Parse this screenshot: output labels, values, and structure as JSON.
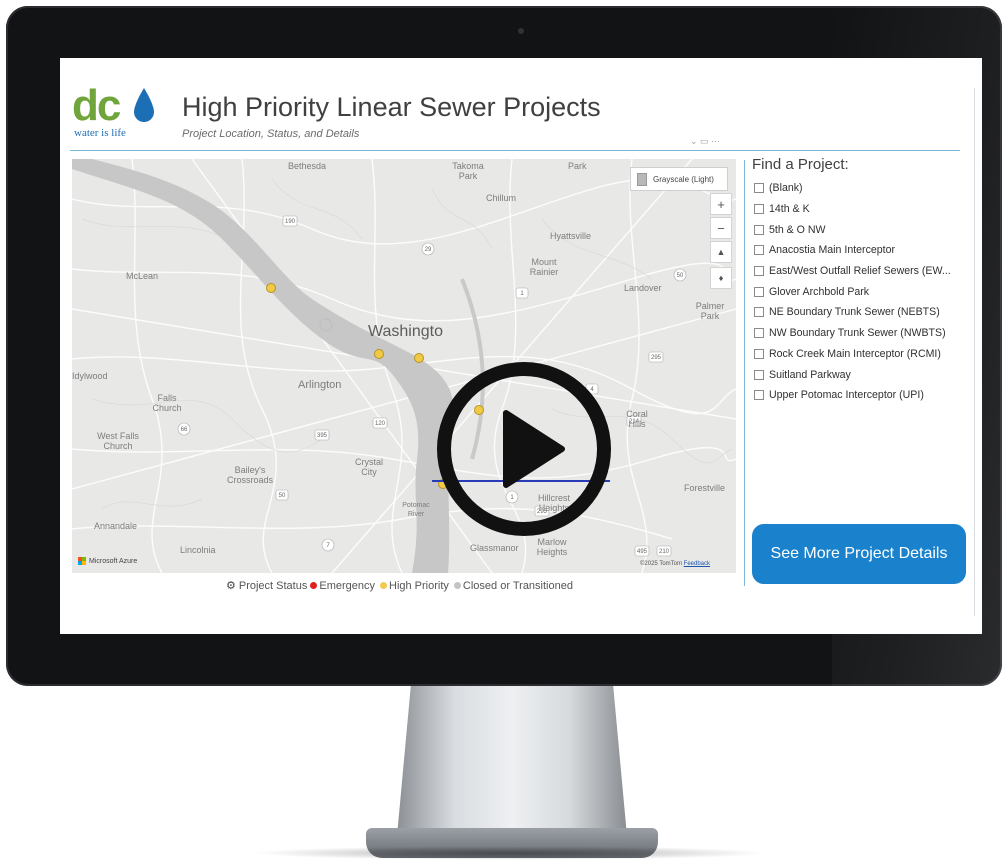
{
  "header": {
    "logo_text": "dc",
    "logo_tagline": "water is life",
    "title": "High Priority Linear Sewer Projects",
    "subtitle": "Project Location, Status, and Details"
  },
  "map": {
    "basemap_button": "Grayscale (Light)",
    "zoom_in": "+",
    "zoom_out": "−",
    "labels": {
      "bethesda": "Bethesda",
      "takoma_park": "Takoma Park",
      "park": "Park",
      "chillum": "Chillum",
      "hyattsville": "Hyattsville",
      "mount_rainier": "Mount Rainier",
      "landover": "Landover",
      "palmer_park": "Palmer Park",
      "mclean": "McLean",
      "washington": "Washingto",
      "arlington": "Arlington",
      "idylwood": "Idylwood",
      "falls_church": "Falls Church",
      "west_falls_church": "West Falls Church",
      "baileys_crossroads": "Bailey's Crossroads",
      "crystal_city": "Crystal City",
      "annandale": "Annandale",
      "lincolnia": "Lincolnia",
      "glassmanor": "Glassmanor",
      "marlow_heights": "Marlow Heights",
      "hillcrest_heights": "Hillcrest Heights",
      "forestville": "Forestville",
      "coral_hills": "Coral Hills",
      "potomac_river": "Potomac River"
    },
    "route_shields": [
      "190",
      "29",
      "1",
      "50",
      "295",
      "4",
      "214",
      "395",
      "66",
      "7",
      "50",
      "495",
      "210",
      "1",
      "295",
      "120"
    ],
    "attribution": "Microsoft Azure",
    "copyright": "©2025 TomTom",
    "feedback": "Feedback"
  },
  "legend": {
    "label": "Project Status",
    "items": [
      {
        "label": "Emergency",
        "color": "#e02020"
      },
      {
        "label": "High Priority",
        "color": "#f2c94c"
      },
      {
        "label": "Closed or Transitioned",
        "color": "#c4c4c4"
      }
    ]
  },
  "filter": {
    "title": "Find a Project:",
    "projects": [
      "(Blank)",
      "14th & K",
      "5th & O NW",
      "Anacostia Main Interceptor",
      "East/West Outfall Relief Sewers (EW...",
      "Glover Archbold Park",
      "NE Boundary Trunk Sewer (NEBTS)",
      "NW Boundary Trunk Sewer (NWBTS)",
      "Rock Creek Main Interceptor (RCMI)",
      "Suitland Parkway",
      "Upper Potomac Interceptor (UPI)"
    ]
  },
  "actions": {
    "details_button": "See More Project Details"
  },
  "colors": {
    "brand_green": "#6fa53a",
    "brand_blue": "#1d6fb5",
    "button_blue": "#1a82cc",
    "pin_yellow": "#f2c94c"
  }
}
